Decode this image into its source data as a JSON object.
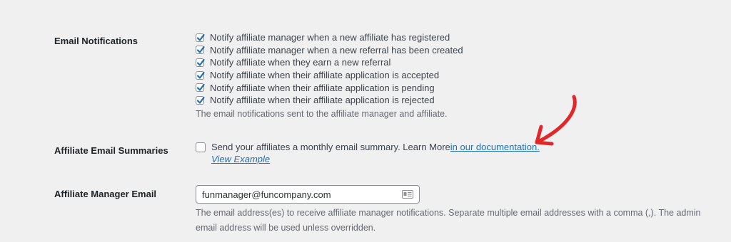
{
  "email_notifications": {
    "label": "Email Notifications",
    "options": [
      {
        "label": "Notify affiliate manager when a new affiliate has registered",
        "checked": true
      },
      {
        "label": "Notify affiliate manager when a new referral has been created",
        "checked": true
      },
      {
        "label": "Notify affiliate when they earn a new referral",
        "checked": true
      },
      {
        "label": "Notify affiliate when their affiliate application is accepted",
        "checked": true
      },
      {
        "label": "Notify affiliate when their affiliate application is pending",
        "checked": true
      },
      {
        "label": "Notify affiliate when their affiliate application is rejected",
        "checked": true
      }
    ],
    "description": "The email notifications sent to the affiliate manager and affiliate."
  },
  "affiliate_email_summaries": {
    "label": "Affiliate Email Summaries",
    "checkbox_text": "Send your affiliates a monthly email summary. Learn More ",
    "checked": false,
    "doc_link": "in our documentation.",
    "view_example": "View Example"
  },
  "affiliate_manager_email": {
    "label": "Affiliate Manager Email",
    "value": "funmanager@funcompany.com",
    "icon": "contact-card-icon",
    "description_line1": "The email address(es) to receive affiliate manager notifications. Separate multiple email addresses with a comma (,). The admin",
    "description_line2": "email address will be used unless overridden."
  },
  "colors": {
    "background": "#f0f0f1",
    "checkbox_check": "#2271b1",
    "link": "#2271b1",
    "annotation_arrow": "#e2262a"
  }
}
